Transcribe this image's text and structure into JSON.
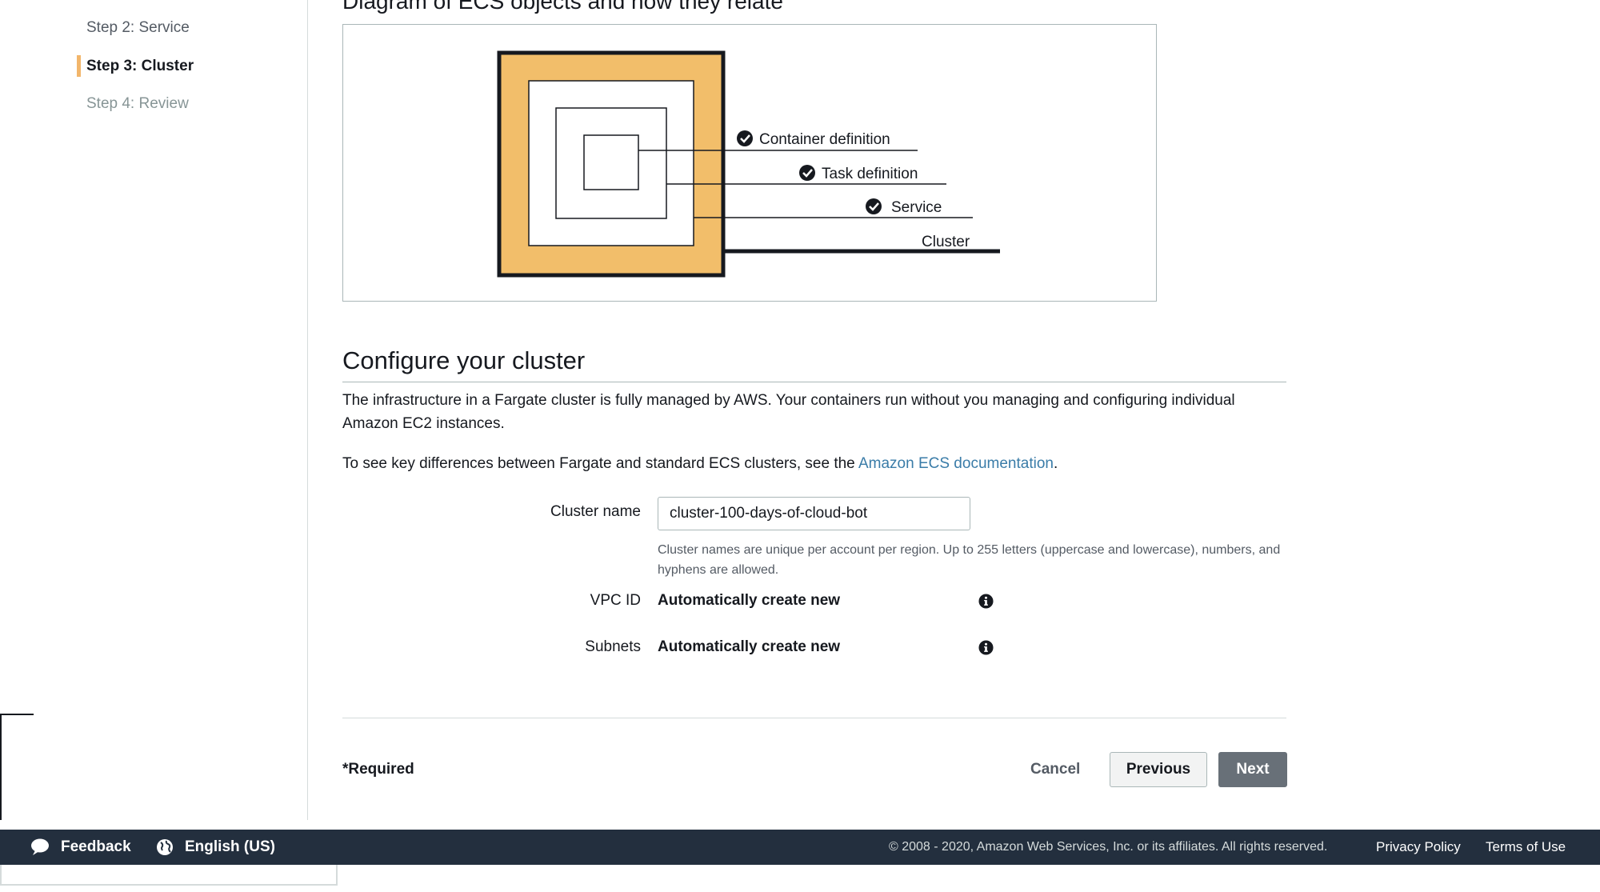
{
  "sidebar": {
    "steps": [
      {
        "label": "Step 2: Service",
        "state": "completed"
      },
      {
        "label": "Step 3: Cluster",
        "state": "active"
      },
      {
        "label": "Step 4: Review",
        "state": "pending"
      }
    ]
  },
  "diagram": {
    "title": "Diagram of ECS objects and how they relate",
    "labels": {
      "container": "Container definition",
      "task": "Task definition",
      "service": "Service",
      "cluster": "Cluster"
    },
    "colors": {
      "cluster_fill": "#f2be6a",
      "outline": "#16191f"
    }
  },
  "configure": {
    "title": "Configure your cluster",
    "paragraph1": "The infrastructure in a Fargate cluster is fully managed by AWS. Your containers run without you managing and configuring individual Amazon EC2 instances.",
    "paragraph2_prefix": "To see key differences between Fargate and standard ECS clusters, see the ",
    "paragraph2_link": "Amazon ECS documentation",
    "paragraph2_suffix": ".",
    "cluster_name": {
      "label": "Cluster name",
      "value": "cluster-100-days-of-cloud-bot",
      "hint": "Cluster names are unique per account per region. Up to 255 letters (uppercase and lowercase), numbers, and hyphens are allowed."
    },
    "vpc": {
      "label": "VPC ID",
      "value": "Automatically create new",
      "icon": "info-icon"
    },
    "subnets": {
      "label": "Subnets",
      "value": "Automatically create new",
      "icon": "info-icon"
    }
  },
  "actions": {
    "required": "*Required",
    "cancel": "Cancel",
    "previous": "Previous",
    "next": "Next"
  },
  "footer": {
    "feedback": "Feedback",
    "language": "English (US)",
    "copyright": "© 2008 - 2020, Amazon Web Services, Inc. or its affiliates. All rights reserved.",
    "privacy": "Privacy Policy",
    "terms": "Terms of Use",
    "background": "#232f3e"
  }
}
